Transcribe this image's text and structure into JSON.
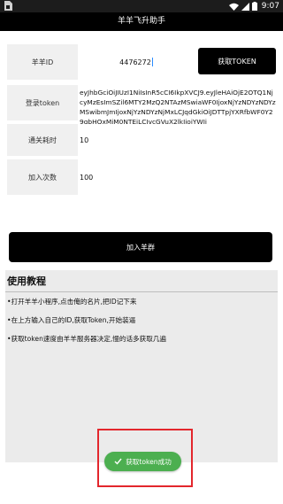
{
  "status_bar": {
    "time": "9:07",
    "icons": [
      "sim-card-icon",
      "wifi-icon",
      "signal-icon",
      "battery-icon"
    ]
  },
  "app_bar": {
    "title": "羊羊飞升助手"
  },
  "form": {
    "id": {
      "label": "羊羊ID",
      "value": "4476272",
      "button_label": "获取TOKEN"
    },
    "token": {
      "label": "登录token",
      "value": "eyJhbGciOiJIUzI1NiIsInR5cCI6IkpXVCJ9.eyJleHAiOjE2OTQ1NjcyMzEsImSZil6MTY2MzQ2NTAzMSwiaWF0IjoxNjYzNDYzNDYzMSwibmJmIjoxNjYzNDYzNjMxLCJqdGkiOiJDTTpjYXRfbWF0Y29gbHQxMjM0NTEiLCJvcGVuX2lkIjoiYWJj"
    },
    "time": {
      "label": "通关耗时",
      "value": "10"
    },
    "count": {
      "label": "加入次数",
      "value": "100"
    }
  },
  "join_button": {
    "label": "加入羊群"
  },
  "tutorial": {
    "title": "使用教程",
    "steps": [
      "•打开羊羊小程序,点击俺的名片,把ID记下来",
      "•在上方输入自己的ID,获取Token,开始装逼",
      "•获取token速度由羊羊服务器决定,慢的话多获取几遍"
    ]
  },
  "toast": {
    "text": "获取token成功",
    "icon": "check-icon"
  },
  "colors": {
    "accent_black": "#000000",
    "toast_green": "#4caf50",
    "highlight_red": "#e3262c",
    "label_bg": "#f0f0f0",
    "tutorial_bg": "#ebebeb"
  }
}
